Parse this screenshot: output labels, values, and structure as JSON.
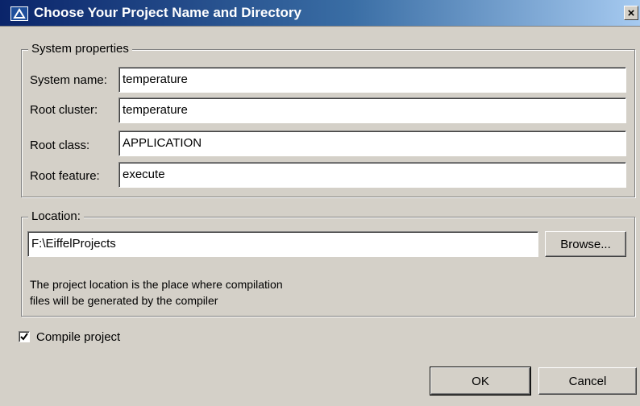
{
  "window": {
    "title": "Choose Your Project Name and Directory",
    "close_symbol": "×",
    "icon": "eiffel-app-icon"
  },
  "system": {
    "legend": "System properties",
    "fields": [
      {
        "label": "System name:",
        "value": "temperature"
      },
      {
        "label": "Root cluster:",
        "value": "temperature"
      },
      {
        "label": "Root class:",
        "value": "APPLICATION"
      },
      {
        "label": "Root feature:",
        "value": "execute"
      }
    ]
  },
  "location": {
    "legend": "Location:",
    "value": "F:\\EiffelProjects",
    "browse_label": "Browse...",
    "info_line1": "The project location is the place where compilation",
    "info_line2": "files will be generated by the compiler"
  },
  "compile": {
    "label": "Compile project",
    "checked": true
  },
  "buttons": {
    "ok": "OK",
    "cancel": "Cancel"
  },
  "colors": {
    "title_start": "#0a246a",
    "title_end": "#a6caf0",
    "face": "#d4d0c8"
  }
}
